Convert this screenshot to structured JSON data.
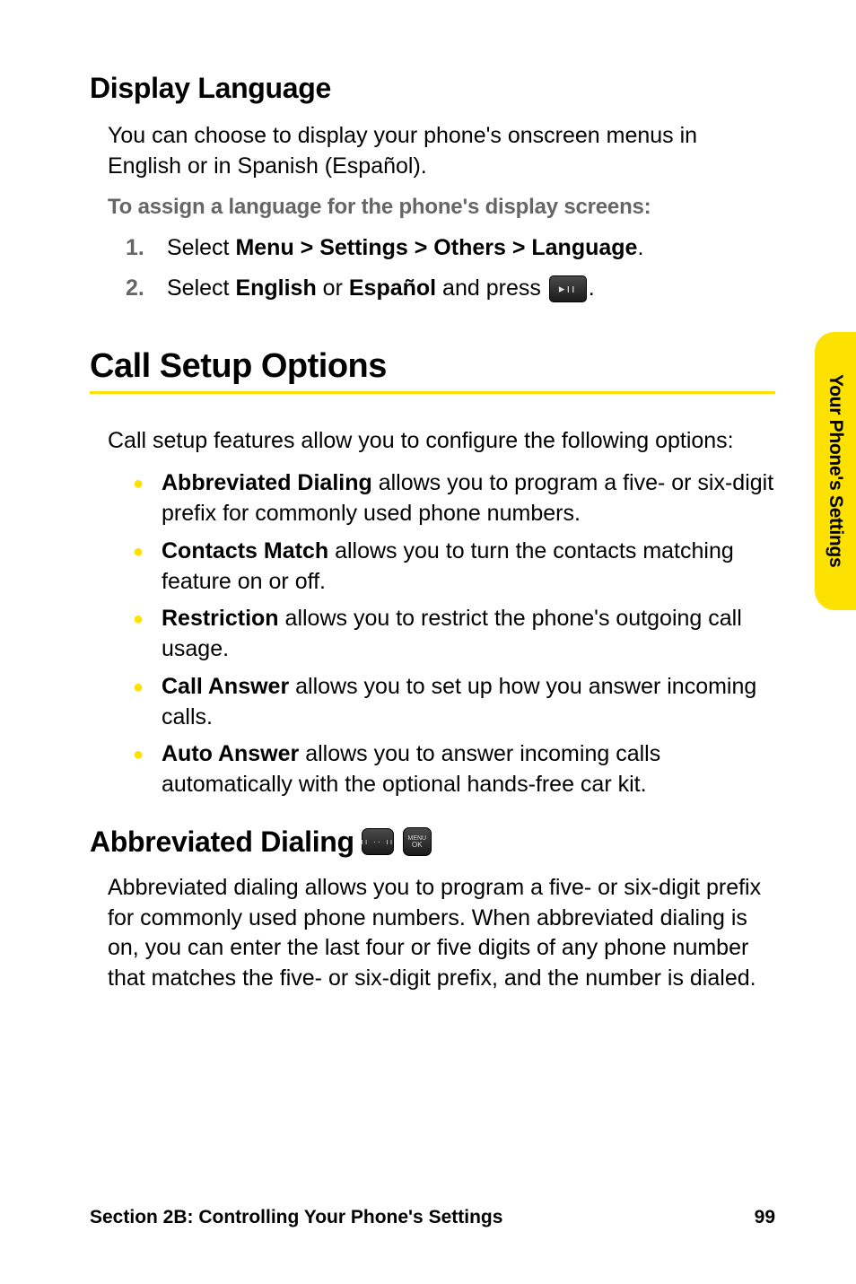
{
  "section1": {
    "heading": "Display Language",
    "intro": "You can choose to display your phone's onscreen menus in English or in Spanish (Español).",
    "instruction": "To assign a language for the phone's display screens:",
    "step1": {
      "num": "1.",
      "pre": "Select ",
      "bold": "Menu > Settings > Others > Language",
      "post": "."
    },
    "step2": {
      "num": "2.",
      "pre": "Select ",
      "b1": "English",
      "mid": " or ",
      "b2": "Español",
      "post": " and press ",
      "end": "."
    }
  },
  "section2": {
    "heading": "Call Setup Options",
    "intro": "Call setup features allow you to configure the following options:",
    "bullets": [
      {
        "b": "Abbreviated Dialing",
        "t": " allows you to program a five- or six-digit prefix for commonly used phone numbers."
      },
      {
        "b": "Contacts Match",
        "t": " allows you to turn the contacts matching feature on or off."
      },
      {
        "b": "Restriction",
        "t": " allows you to restrict the phone's outgoing call usage."
      },
      {
        "b": "Call Answer",
        "t": " allows you to set up how you answer incoming calls."
      },
      {
        "b": "Auto Answer",
        "t": " allows you to answer incoming calls automatically with the optional hands-free car kit."
      }
    ]
  },
  "section3": {
    "heading": "Abbreviated Dialing",
    "body": "Abbreviated dialing allows you to program a five- or six-digit prefix for commonly used phone numbers. When abbreviated dialing is on, you can enter the last four or five digits of any phone number that matches the five- or six-digit prefix, and the number is dialed."
  },
  "tab": "Your Phone's Settings",
  "footer": {
    "left": "Section 2B: Controlling Your Phone's Settings",
    "right": "99"
  }
}
